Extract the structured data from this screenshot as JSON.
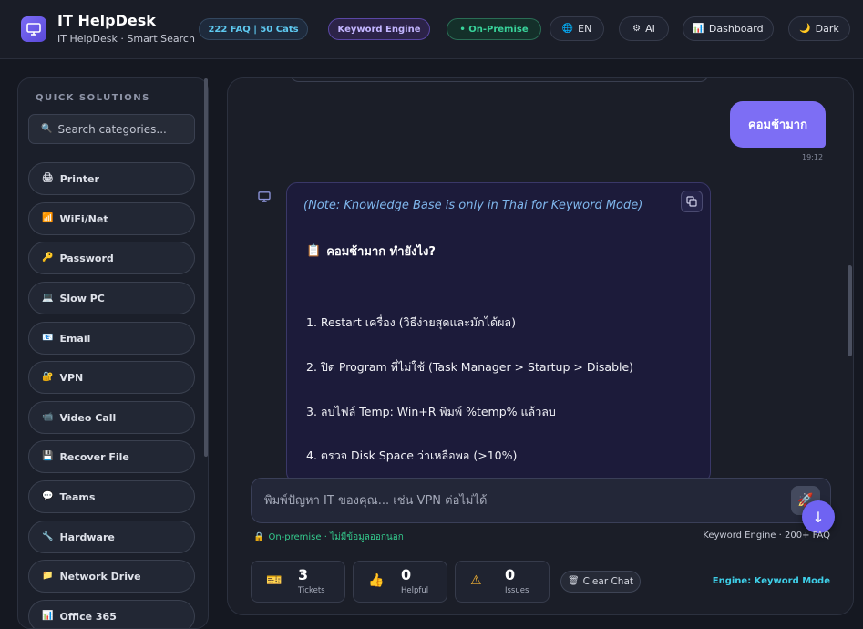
{
  "header": {
    "title": "IT HelpDesk",
    "subtitle": "IT HelpDesk · Smart Search",
    "stats_pill": "222 FAQ | 50 Cats",
    "engine_pill": "Keyword Engine",
    "onprem_pill": "• On-Premise",
    "buttons": {
      "language": {
        "icon": "globe-icon",
        "glyph": "🌐",
        "label": "EN"
      },
      "ai": {
        "icon": "gear-icon",
        "glyph": "⚙",
        "label": "AI"
      },
      "dashboard": {
        "icon": "chart-icon",
        "glyph": "📊",
        "label": "Dashboard"
      },
      "theme": {
        "icon": "moon-icon",
        "glyph": "🌙",
        "label": "Dark"
      }
    }
  },
  "sidebar": {
    "title": "QUICK SOLUTIONS",
    "search_placeholder": "Search categories...",
    "search_glyph": "🔍",
    "items": [
      {
        "icon": "printer-icon",
        "glyph": "🖨",
        "label": "Printer"
      },
      {
        "icon": "signal-icon",
        "glyph": "📶",
        "label": "WiFi/Net"
      },
      {
        "icon": "key-icon",
        "glyph": "🔑",
        "label": "Password"
      },
      {
        "icon": "laptop-icon",
        "glyph": "💻",
        "label": "Slow PC"
      },
      {
        "icon": "email-icon",
        "glyph": "📧",
        "label": "Email"
      },
      {
        "icon": "lock-icon",
        "glyph": "🔐",
        "label": "VPN"
      },
      {
        "icon": "camera-icon",
        "glyph": "📹",
        "label": "Video Call"
      },
      {
        "icon": "disk-icon",
        "glyph": "💾",
        "label": "Recover File"
      },
      {
        "icon": "chat-bubble-icon",
        "glyph": "💬",
        "label": "Teams"
      },
      {
        "icon": "wrench-icon",
        "glyph": "🔧",
        "label": "Hardware"
      },
      {
        "icon": "folder-icon",
        "glyph": "📁",
        "label": "Network Drive"
      },
      {
        "icon": "office-icon",
        "glyph": "📊",
        "label": "Office 365"
      }
    ]
  },
  "chat": {
    "user_message": "คอมช้ามาก",
    "user_time": "19:12",
    "bot": {
      "note": "(Note: Knowledge Base is only in Thai for Keyword Mode)",
      "heading_glyph": "📋",
      "heading": "คอมช้ามาก ทำยังไง?",
      "steps": [
        "1. Restart เครื่อง (วิธีง่ายสุดและมักได้ผล)",
        "2. ปิด Program ที่ไม่ใช้ (Task Manager > Startup > Disable)",
        "3. ลบไฟล์ Temp: Win+R พิมพ์ %temp% แล้วลบ",
        "4. ตรวจ Disk Space ว่าเหลือพอ (>10%)"
      ]
    },
    "composer_placeholder": "พิมพ์ปัญหา IT ของคุณ... เช่น VPN ต่อไม่ได้",
    "send_glyph": "🚀",
    "scroll_down_glyph": "↓",
    "onprem_note": "On-premise · ไม่มีข้อมูลออกนอก",
    "onprem_glyph": "🔒",
    "engine_note": "Keyword Engine · 200+ FAQ"
  },
  "stats": {
    "tickets": {
      "value": "3",
      "label": "Tickets",
      "glyph": "🎫"
    },
    "helpful": {
      "value": "0",
      "label": "Helpful",
      "glyph": "👍"
    },
    "issues": {
      "value": "0",
      "label": "Issues",
      "glyph": "⚠"
    },
    "clear_label": "Clear Chat",
    "clear_glyph": "🗑",
    "engine_label": "Engine:",
    "engine_value": "Keyword Mode"
  }
}
